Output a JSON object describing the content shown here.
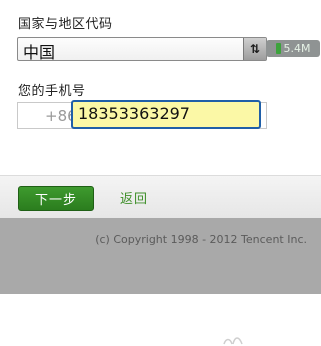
{
  "form": {
    "country_label": "国家与地区代码",
    "country_value": "中国",
    "phone_label": "您的手机号",
    "prefix": "+86",
    "phone_value": "18353363297"
  },
  "overlay": {
    "size_badge": "5.4M"
  },
  "actions": {
    "next_label": "下一步",
    "back_label": "返回"
  },
  "footer": {
    "copyright": "(c) Copyright 1998 - 2012 Tencent Inc."
  },
  "colors": {
    "accent_green": "#2b7d1e",
    "input_focus_border": "#1f5fa8",
    "input_highlight": "#fbf8a6",
    "footer_gray": "#a9a9a9"
  },
  "icons": {
    "select_arrow": "sort-arrows-icon",
    "badge_icon": "battery-icon",
    "deco_icon": "decorative-mark-icon"
  }
}
